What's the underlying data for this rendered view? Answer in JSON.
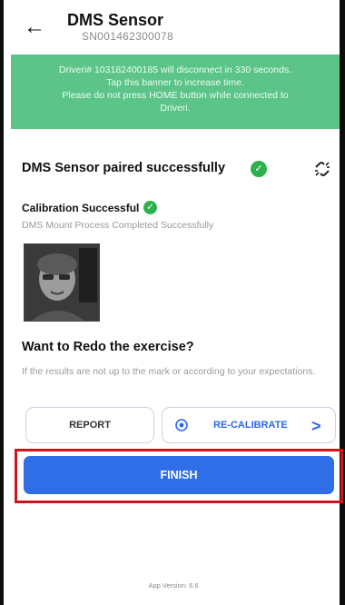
{
  "header": {
    "back_icon": "arrow-left-icon",
    "title": "DMS Sensor",
    "subtitle": "SN001462300078"
  },
  "banner": {
    "line1": "Driveri# 103182400185 will disconnect in 330 seconds.",
    "line2": "Tap this banner to increase time.",
    "line3": "Please do not press HOME button while connected to",
    "line4": "Driveri.",
    "color": "#5cc389"
  },
  "status": {
    "paired_text": "DMS Sensor paired successfully",
    "check_icon": "check-circle-icon",
    "unlink_icon": "unlink-icon"
  },
  "calibration": {
    "title": "Calibration Successful",
    "subtitle": "DMS Mount Process Completed Successfully",
    "image": "driver-face-photo"
  },
  "redo": {
    "title": "Want to Redo the exercise?",
    "description": "If the results are not up to the mark or according to your expectations."
  },
  "buttons": {
    "report": "REPORT",
    "recalibrate": "RE-CALIBRATE",
    "chevron": ">",
    "finish": "FINISH"
  },
  "footer": {
    "version": "App Version: 6.6"
  },
  "colors": {
    "primary": "#2f6ee7",
    "success": "#2bb24c",
    "highlight": "#d0131c"
  }
}
